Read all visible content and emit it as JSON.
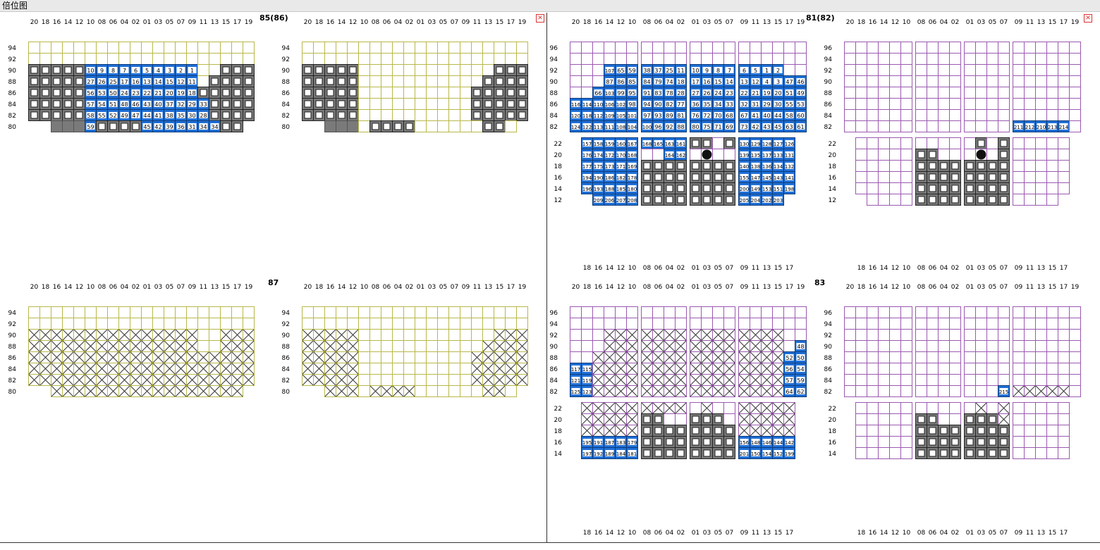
{
  "window": {
    "title": "倍位图"
  },
  "bays": [
    {
      "label": "85(86)",
      "type": "deck"
    },
    {
      "label": "81(82)",
      "type": "hold"
    },
    {
      "label": "87",
      "type": "deck"
    },
    {
      "label": "83",
      "type": "hold"
    }
  ],
  "deck_columns": [
    "20",
    "18",
    "16",
    "14",
    "12",
    "10",
    "08",
    "06",
    "04",
    "02",
    "01",
    "03",
    "05",
    "07",
    "09",
    "11",
    "13",
    "15",
    "17",
    "19"
  ],
  "deck_tiers": [
    "94",
    "92",
    "90",
    "88",
    "86",
    "84",
    "82",
    "80"
  ],
  "hold_top_tiers": [
    "96",
    "94",
    "92",
    "90",
    "88",
    "86",
    "84",
    "82"
  ],
  "hold_bottom_tiers_81": [
    "22",
    "20",
    "18",
    "16",
    "14",
    "12"
  ],
  "hold_bottom_tiers_83": [
    "22",
    "20",
    "18",
    "16",
    "14"
  ],
  "hold_bottom_columns": [
    "18",
    "16",
    "14",
    "12",
    "10",
    "08",
    "06",
    "04",
    "02",
    "01",
    "03",
    "05",
    "07",
    "09",
    "11",
    "13",
    "15",
    "17"
  ],
  "colors": {
    "deck_grid": "#b8b84a",
    "hold_grid": "#9a59b0",
    "blue": "#1f6fd6",
    "gray": "#7a7a7a",
    "divider": "#333333"
  },
  "icons": [
    "close-icon"
  ],
  "slot_numbers": {
    "b85_r90": [
      "10",
      "9",
      "8",
      "7",
      "6",
      "5",
      "4",
      "3",
      "2",
      "1"
    ],
    "b85_r88": [
      "27",
      "26",
      "25",
      "17",
      "16",
      "13",
      "14",
      "15",
      "12",
      "11"
    ],
    "b85_r86": [
      "56",
      "53",
      "50",
      "24",
      "23",
      "22",
      "21",
      "20",
      "19",
      "18"
    ],
    "b85_r84": [
      "57",
      "54",
      "51",
      "48",
      "46",
      "43",
      "40",
      "37",
      "32",
      "29",
      "33"
    ],
    "b85_r82": [
      "58",
      "55",
      "52",
      "49",
      "47",
      "44",
      "41",
      "38",
      "35",
      "30",
      "28"
    ],
    "b85_r80": [
      "59",
      "45",
      "42",
      "39",
      "36",
      "31",
      "34"
    ],
    "b81_r92": [
      "107",
      "65",
      "59",
      "38",
      "37",
      "25",
      "11",
      "10",
      "9",
      "8",
      "7",
      "6",
      "5",
      "1",
      "2"
    ],
    "b81_r90": [
      "87",
      "86",
      "85",
      "84",
      "79",
      "74",
      "18",
      "17",
      "16",
      "15",
      "14",
      "13",
      "12",
      "4",
      "3",
      "47",
      "46"
    ],
    "b81_r88": [
      "66",
      "103",
      "99",
      "95",
      "91",
      "83",
      "78",
      "28",
      "27",
      "26",
      "24",
      "23",
      "22",
      "21",
      "19",
      "20",
      "51",
      "49"
    ],
    "b81_r86": [
      "116",
      "114",
      "110",
      "106",
      "102",
      "98",
      "94",
      "90",
      "82",
      "77",
      "36",
      "35",
      "34",
      "33",
      "32",
      "31",
      "29",
      "30",
      "55",
      "53"
    ],
    "b81_r84": [
      "120",
      "118",
      "112",
      "109",
      "105",
      "101",
      "97",
      "93",
      "89",
      "81",
      "76",
      "72",
      "70",
      "68",
      "67",
      "41",
      "40",
      "44",
      "58",
      "60"
    ],
    "b81_r82": [
      "124",
      "122",
      "113",
      "111",
      "108",
      "104",
      "100",
      "96",
      "92",
      "88",
      "80",
      "75",
      "71",
      "69",
      "73",
      "42",
      "43",
      "45",
      "63",
      "61"
    ],
    "b81_r22": [
      "157",
      "158",
      "159",
      "160",
      "167",
      "168",
      "165",
      "163",
      "161",
      "130",
      "129",
      "128",
      "127",
      "126"
    ],
    "b81_r20": [
      "176",
      "174",
      "172",
      "170",
      "168",
      "164",
      "162",
      "139",
      "135",
      "137",
      "133",
      "131"
    ],
    "b81_r18": [
      "177",
      "175",
      "173",
      "171",
      "169",
      "140",
      "138",
      "136",
      "134",
      "132"
    ],
    "b81_r16": [
      "194",
      "190",
      "186",
      "182",
      "178",
      "155",
      "147",
      "145",
      "143",
      "141"
    ],
    "b81_r14": [
      "196",
      "193",
      "188",
      "185",
      "180",
      "200",
      "149",
      "153",
      "151",
      "198"
    ],
    "b81_r12": [
      "209",
      "206",
      "207",
      "208",
      "205",
      "204",
      "202",
      "203"
    ],
    "b82_r82": [
      "211",
      "212",
      "210",
      "213",
      "214"
    ],
    "b83_r90": [
      "48"
    ],
    "b83_r88": [
      "52",
      "50"
    ],
    "b83_r86": [
      "117",
      "115",
      "56",
      "54"
    ],
    "b83_r84": [
      "121",
      "119",
      "57",
      "59"
    ],
    "b83_r82": [
      "125",
      "123",
      "64",
      "62"
    ],
    "b83_r16": [
      "195",
      "191",
      "187",
      "183",
      "179",
      "156",
      "148",
      "146",
      "144",
      "142"
    ],
    "b83_r14": [
      "197",
      "192",
      "189",
      "184",
      "181",
      "201",
      "150",
      "154",
      "152",
      "199"
    ],
    "b84_r82": [
      "215"
    ]
  }
}
